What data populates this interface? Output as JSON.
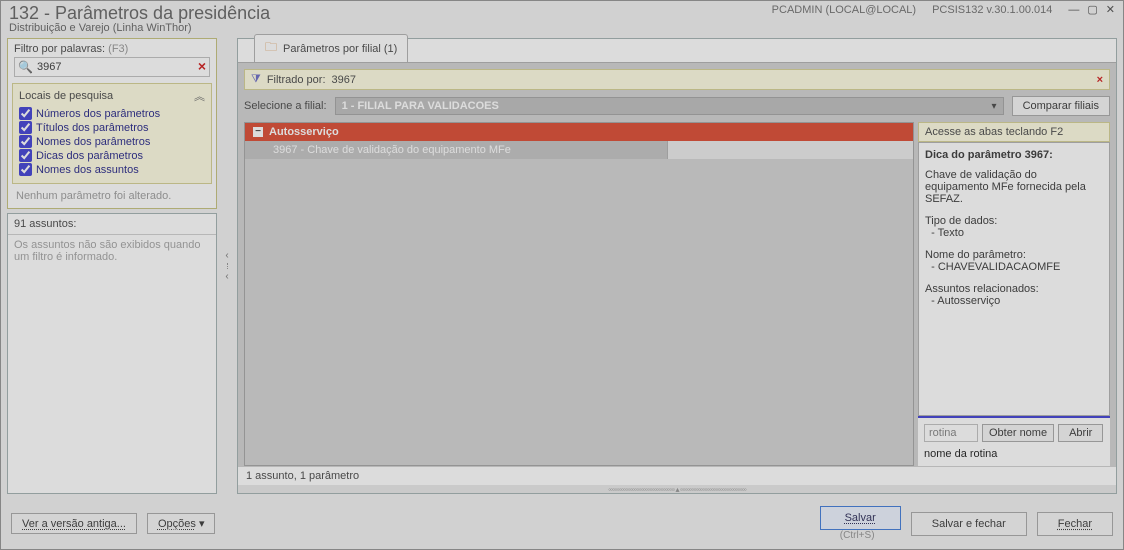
{
  "window": {
    "title": "132 - Parâmetros da presidência",
    "subtitle": "Distribuição e Varejo (Linha WinThor)",
    "user": "PCADMIN (LOCAL@LOCAL)",
    "build": "PCSIS132  v.30.1.00.014"
  },
  "filter": {
    "label": "Filtro por palavras:",
    "shortcut": "(F3)",
    "value": "3967"
  },
  "locais": {
    "title": "Locais de pesquisa",
    "items": [
      "Números dos parâmetros",
      "Títulos dos parâmetros",
      "Nomes dos parâmetros",
      "Dicas dos parâmetros",
      "Nomes dos assuntos"
    ],
    "status": "Nenhum parâmetro foi alterado."
  },
  "subjects": {
    "header": "91 assuntos:",
    "empty": "Os assuntos não são exibidos quando um filtro é informado."
  },
  "tab": {
    "label": "Parâmetros por filial  (1)"
  },
  "filterbar": {
    "prefix": "Filtrado por:",
    "value": "3967"
  },
  "filial": {
    "label": "Selecione a filial:",
    "selected": "1 - FILIAL PARA VALIDACOES",
    "compare": "Comparar filiais"
  },
  "tree": {
    "group": "Autosserviço",
    "param": "3967 - Chave de validação do equipamento MFe"
  },
  "help": {
    "hint": "Acesse as abas teclando F2",
    "title": "Dica do parâmetro 3967:",
    "desc": "Chave de validação do equipamento MFe fornecida pela SEFAZ.",
    "typeLabel": "Tipo de dados:",
    "typeValue": "- Texto",
    "nameLabel": "Nome do parâmetro:",
    "nameValue": "- CHAVEVALIDACAOMFE",
    "relLabel": "Assuntos relacionados:",
    "relValue": "- Autosserviço"
  },
  "rotina": {
    "placeholder": "rotina",
    "btn1": "Obter nome",
    "btn2": "Abrir",
    "caption": "nome da rotina"
  },
  "count": "1 assunto, 1 parâmetro",
  "footer": {
    "oldver": "Ver a versão antiga...",
    "options": "Opções",
    "save": "Salvar",
    "saveHint": "(Ctrl+S)",
    "saveClose": "Salvar e fechar",
    "close": "Fechar"
  }
}
